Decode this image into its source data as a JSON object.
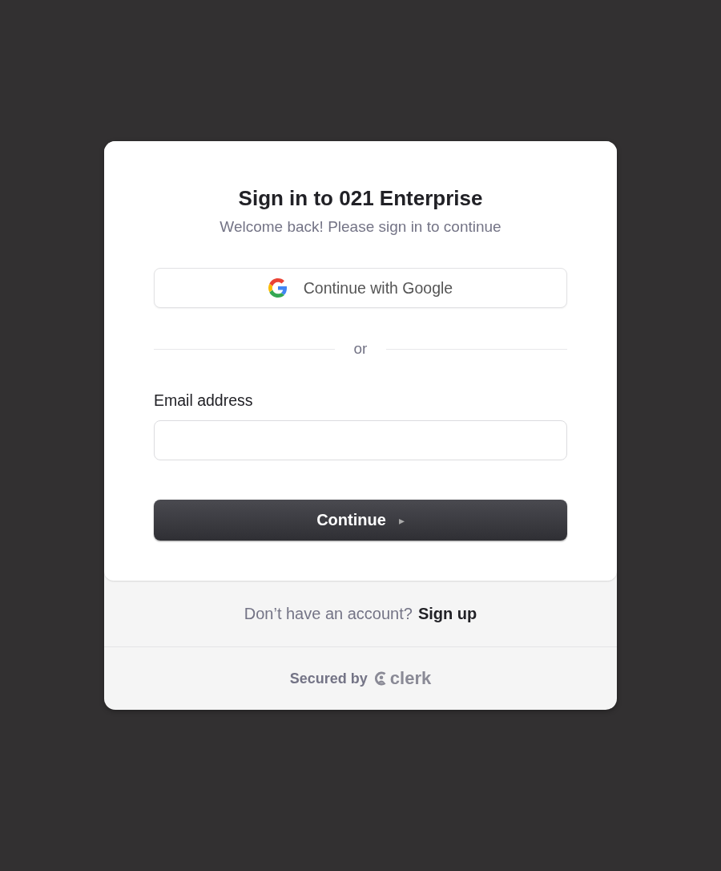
{
  "header": {
    "title": "Sign in to 021 Enterprise",
    "subtitle": "Welcome back! Please sign in to continue"
  },
  "social_buttons": [
    {
      "kind": "google",
      "label": "Continue with Google"
    }
  ],
  "divider": {
    "label": "or"
  },
  "fields": [
    {
      "label": "Email address"
    }
  ],
  "primary_button": {
    "label": "Continue",
    "icon": "▸"
  },
  "footer": {
    "prompt": "Don’t have an account?",
    "link": "Sign up",
    "secured_by": "Secured by",
    "brand": "clerk"
  }
}
